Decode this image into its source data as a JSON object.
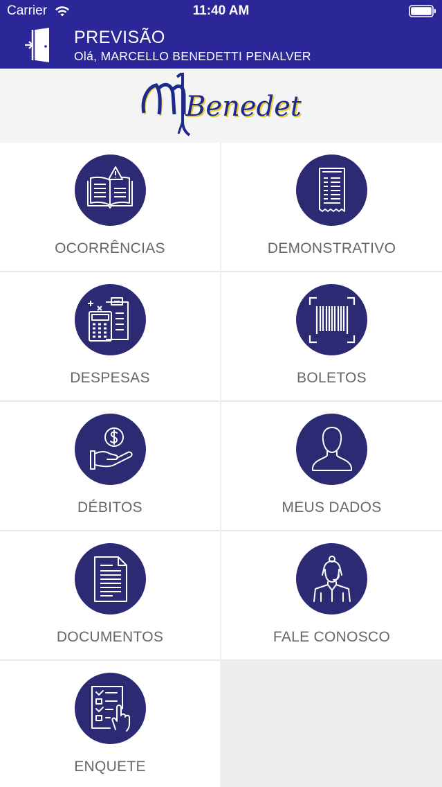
{
  "status_bar": {
    "carrier": "Carrier",
    "time": "11:40 AM"
  },
  "header": {
    "title": "PREVISÃO",
    "subtitle": "Olá, MARCELLO BENEDETTI PENALVER"
  },
  "logo": {
    "text": "Benedetti"
  },
  "colors": {
    "header_bg": "#2b2799",
    "icon_circle": "#2b2a73",
    "label_text": "#666666",
    "logo_blue": "#1d2a8a",
    "logo_accent": "#e8c838"
  },
  "menu": [
    {
      "label": "OCORRÊNCIAS",
      "icon": "open-book-warning-icon"
    },
    {
      "label": "DEMONSTRATIVO",
      "icon": "receipt-icon"
    },
    {
      "label": "DESPESAS",
      "icon": "calculator-icon"
    },
    {
      "label": "BOLETOS",
      "icon": "barcode-icon"
    },
    {
      "label": "DÉBITOS",
      "icon": "hand-coin-icon"
    },
    {
      "label": "MEUS DADOS",
      "icon": "user-icon"
    },
    {
      "label": "DOCUMENTOS",
      "icon": "document-icon"
    },
    {
      "label": "FALE CONOSCO",
      "icon": "support-agent-icon"
    },
    {
      "label": "ENQUETE",
      "icon": "survey-checklist-icon"
    }
  ]
}
